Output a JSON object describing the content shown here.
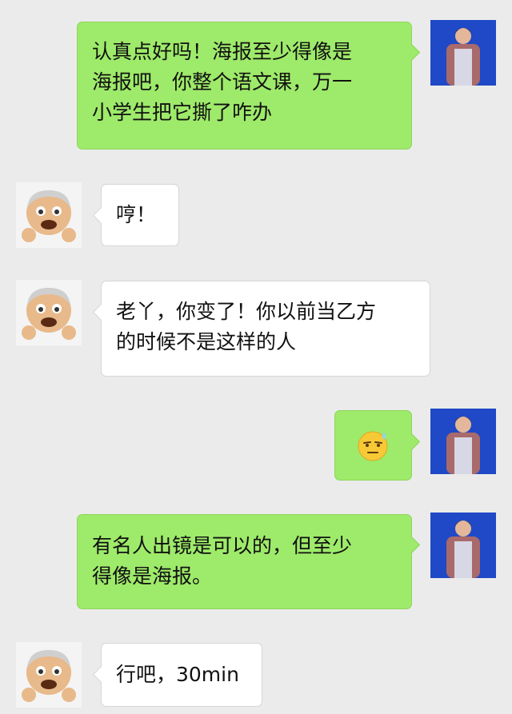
{
  "chat": {
    "messages": [
      {
        "side": "right",
        "lines": [
          "认真点好吗！海报至少得像是",
          "海报吧，你整个语文课，万一",
          "小学生把它撕了咋办"
        ]
      },
      {
        "side": "left",
        "lines": [
          "哼！"
        ]
      },
      {
        "side": "left",
        "lines": [
          "老丫，你变了！你以前当乙方",
          "的时候不是这样的人"
        ]
      },
      {
        "side": "right",
        "emoji": "😓"
      },
      {
        "side": "right",
        "lines": [
          "有名人出镜是可以的，但至少",
          "得像是海报。"
        ]
      },
      {
        "side": "left",
        "lines": [
          "行吧，30min"
        ]
      }
    ]
  },
  "colors": {
    "background": "#ebebeb",
    "sent_bubble": "#9eea6a",
    "received_bubble": "#ffffff",
    "self_avatar_bg": "#1f49c6"
  },
  "avatars": {
    "self": "woman-standing-photo",
    "other": "old-man-emoji-face"
  }
}
